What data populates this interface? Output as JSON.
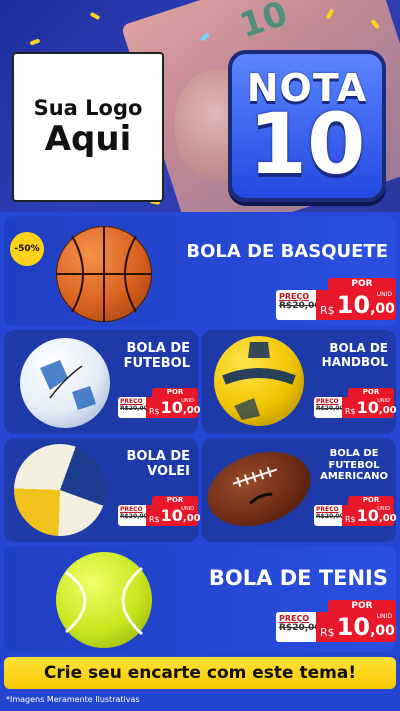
{
  "header": {
    "logo_line1": "Sua Logo",
    "logo_line2": "Aqui",
    "nota_word": "NOTA",
    "nota_number": "10",
    "bill_number": "10"
  },
  "featured_top": {
    "badge": "-50%",
    "title": "BOLA DE BASQUETE",
    "price": {
      "por": "POR",
      "preco": "PREÇO",
      "old": "R$20,00",
      "currency": "R$",
      "value": "10",
      "cents": ",00",
      "unit": "UNID"
    }
  },
  "grid": [
    {
      "title_lines": [
        "BOLA DE",
        "FUTEBOL"
      ],
      "price": {
        "por": "POR",
        "preco": "PREÇO",
        "old": "R$20,00",
        "currency": "R$",
        "value": "10",
        "cents": ",00",
        "unit": "UNID"
      }
    },
    {
      "title_lines": [
        "BOLA DE",
        "HANDBOL"
      ],
      "price": {
        "por": "POR",
        "preco": "PREÇO",
        "old": "R$20,00",
        "currency": "R$",
        "value": "10",
        "cents": ",00",
        "unit": "UNID"
      }
    },
    {
      "title_lines": [
        "BOLA DE",
        "VOLEI"
      ],
      "price": {
        "por": "POR",
        "preco": "PREÇO",
        "old": "R$20,00",
        "currency": "R$",
        "value": "10",
        "cents": ",00",
        "unit": "UNID"
      }
    },
    {
      "title_lines": [
        "BOLA DE",
        "FUTEBOL",
        "AMERICANO"
      ],
      "price": {
        "por": "POR",
        "preco": "PREÇO",
        "old": "R$20,00",
        "currency": "R$",
        "value": "10",
        "cents": ",00",
        "unit": "UNID"
      }
    }
  ],
  "featured_bottom": {
    "title": "BOLA DE TENIS",
    "price": {
      "por": "POR",
      "preco": "PREÇO",
      "old": "R$20,00",
      "currency": "R$",
      "value": "10",
      "cents": ",00",
      "unit": "UNID"
    }
  },
  "cta": "Crie seu encarte com este tema!",
  "footnote": "*Imagens Meramente Ilustrativas",
  "colors": {
    "accent_yellow": "#ffd21a",
    "price_red": "#e8182a",
    "panel_blue": "#1d3aa8",
    "background_blue": "#2747d8"
  },
  "icons": [
    "basketball-icon",
    "soccer-ball-icon",
    "handball-icon",
    "volleyball-icon",
    "american-football-icon",
    "tennis-ball-icon"
  ]
}
